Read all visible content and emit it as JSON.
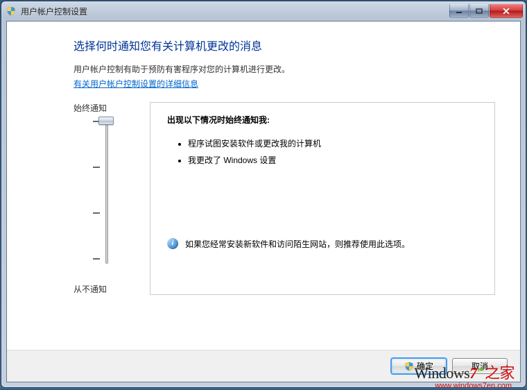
{
  "window": {
    "title": "用户帐户控制设置"
  },
  "page": {
    "title": "选择何时通知您有关计算机更改的消息",
    "intro": "用户帐户控制有助于预防有害程序对您的计算机进行更改。",
    "link": "有关用户帐户控制设置的详细信息"
  },
  "slider": {
    "top_label": "始终通知",
    "bottom_label": "从不通知"
  },
  "desc": {
    "heading": "出现以下情况时始终通知我:",
    "bullets": [
      "程序试图安装软件或更改我的计算机",
      "我更改了 Windows 设置"
    ],
    "note": "如果您经常安装新软件和访问陌生网站，则推荐使用此选项。"
  },
  "buttons": {
    "ok": "确定",
    "cancel": "取消"
  },
  "watermark": {
    "brand_prefix": "Windows",
    "brand_seven": "7",
    "brand_suffix": "之家",
    "url": "www.windows7en.com"
  }
}
